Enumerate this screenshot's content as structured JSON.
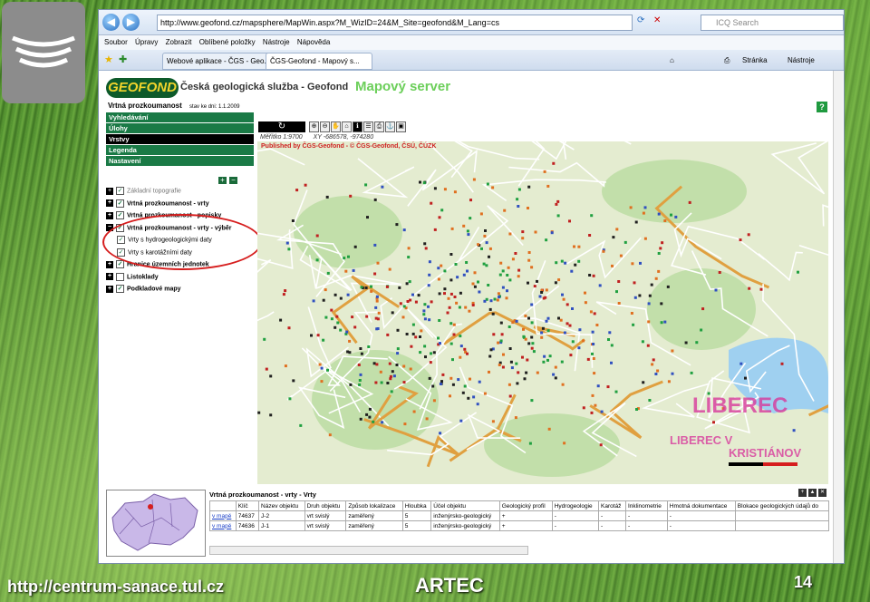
{
  "browser": {
    "url": "http://www.geofond.cz/mapsphere/MapWin.aspx?M_WizID=24&M_Site=geofond&M_Lang=cs",
    "search_placeholder": "ICQ Search",
    "menu": [
      "Soubor",
      "Úpravy",
      "Zobrazit",
      "Oblíbené položky",
      "Nástroje",
      "Nápověda"
    ],
    "tabs": [
      "Webové aplikace - ČGS - Geo...",
      "ČGS-Geofond - Mapový s..."
    ],
    "commands": [
      "Stránka",
      "Nástroje"
    ]
  },
  "page": {
    "logo": "GEOFOND",
    "org_name": "Česká geologická služba - Geofond",
    "server_name": "Mapový server",
    "layer_title": "Vrtná prozkoumanost",
    "layer_date": "stav ke dni: 1.1.2009",
    "help": "?",
    "menu": [
      {
        "label": "Vyhledávání",
        "active": false
      },
      {
        "label": "Úlohy",
        "active": false
      },
      {
        "label": "Vrstvy",
        "active": true
      },
      {
        "label": "Legenda",
        "active": false
      },
      {
        "label": "Nastavení",
        "active": false
      }
    ],
    "layers": [
      {
        "label": "Základní topografie",
        "expand": "+",
        "checked": true,
        "bold": false,
        "grey": true,
        "indent": false
      },
      {
        "label": "Vrtná prozkoumanost - vrty",
        "expand": "+",
        "checked": true,
        "bold": true,
        "grey": false,
        "indent": false
      },
      {
        "label": "Vrtná prozkoumanost - popisky",
        "expand": "+",
        "checked": true,
        "bold": true,
        "grey": false,
        "indent": false
      },
      {
        "label": "Vrtná prozkoumanost - vrty - výběr",
        "expand": "−",
        "checked": true,
        "bold": true,
        "grey": false,
        "indent": false
      },
      {
        "label": "Vrty s hydrogeologickými daty",
        "expand": "",
        "checked": true,
        "bold": false,
        "grey": false,
        "indent": true
      },
      {
        "label": "Vrty s karotážními daty",
        "expand": "",
        "checked": true,
        "bold": false,
        "grey": false,
        "indent": true
      },
      {
        "label": "Hranice územních jednotek",
        "expand": "+",
        "checked": true,
        "bold": true,
        "grey": false,
        "indent": false
      },
      {
        "label": "Listoklady",
        "expand": "+",
        "checked": false,
        "bold": true,
        "grey": false,
        "indent": false
      },
      {
        "label": "Podkladové mapy",
        "expand": "+",
        "checked": true,
        "bold": true,
        "grey": false,
        "indent": false
      }
    ],
    "map": {
      "scale": "Měřítko 1:9700",
      "coords": "XY -686578, -974280",
      "published": "Published by ČGS-Geofond - © ČGS-Geofond, ČSÚ, ČÚZK",
      "city_labels": [
        "LIBEREC",
        "LIBEREC V",
        "KRISTIÁNOV"
      ]
    },
    "results": {
      "title": "Vrtná prozkoumanost - vrty - Vrty",
      "headers": [
        "",
        "Klíč",
        "Název objektu",
        "Druh objektu",
        "Způsob lokalizace",
        "Hloubka",
        "Účel objektu",
        "Geologický profil",
        "Hydrogeologie",
        "Karotáž",
        "Inklinometrie",
        "Hmotná dokumentace",
        "Blokace geologických údajů do"
      ],
      "rows": [
        [
          "v mapě",
          "74637",
          "J-2",
          "vrt svislý",
          "zaměřený",
          "5",
          "inženýrsko-geologický",
          "+",
          "-",
          "-",
          "-",
          "-",
          ""
        ],
        [
          "v mapě",
          "74636",
          "J-1",
          "vrt svislý",
          "zaměřený",
          "5",
          "inženýrsko-geologický",
          "+",
          "-",
          "-",
          "-",
          "-",
          ""
        ]
      ]
    }
  },
  "footer": {
    "url": "http://centrum-sanace.tul.cz",
    "brand": "ARTEC",
    "page_number": "14"
  }
}
